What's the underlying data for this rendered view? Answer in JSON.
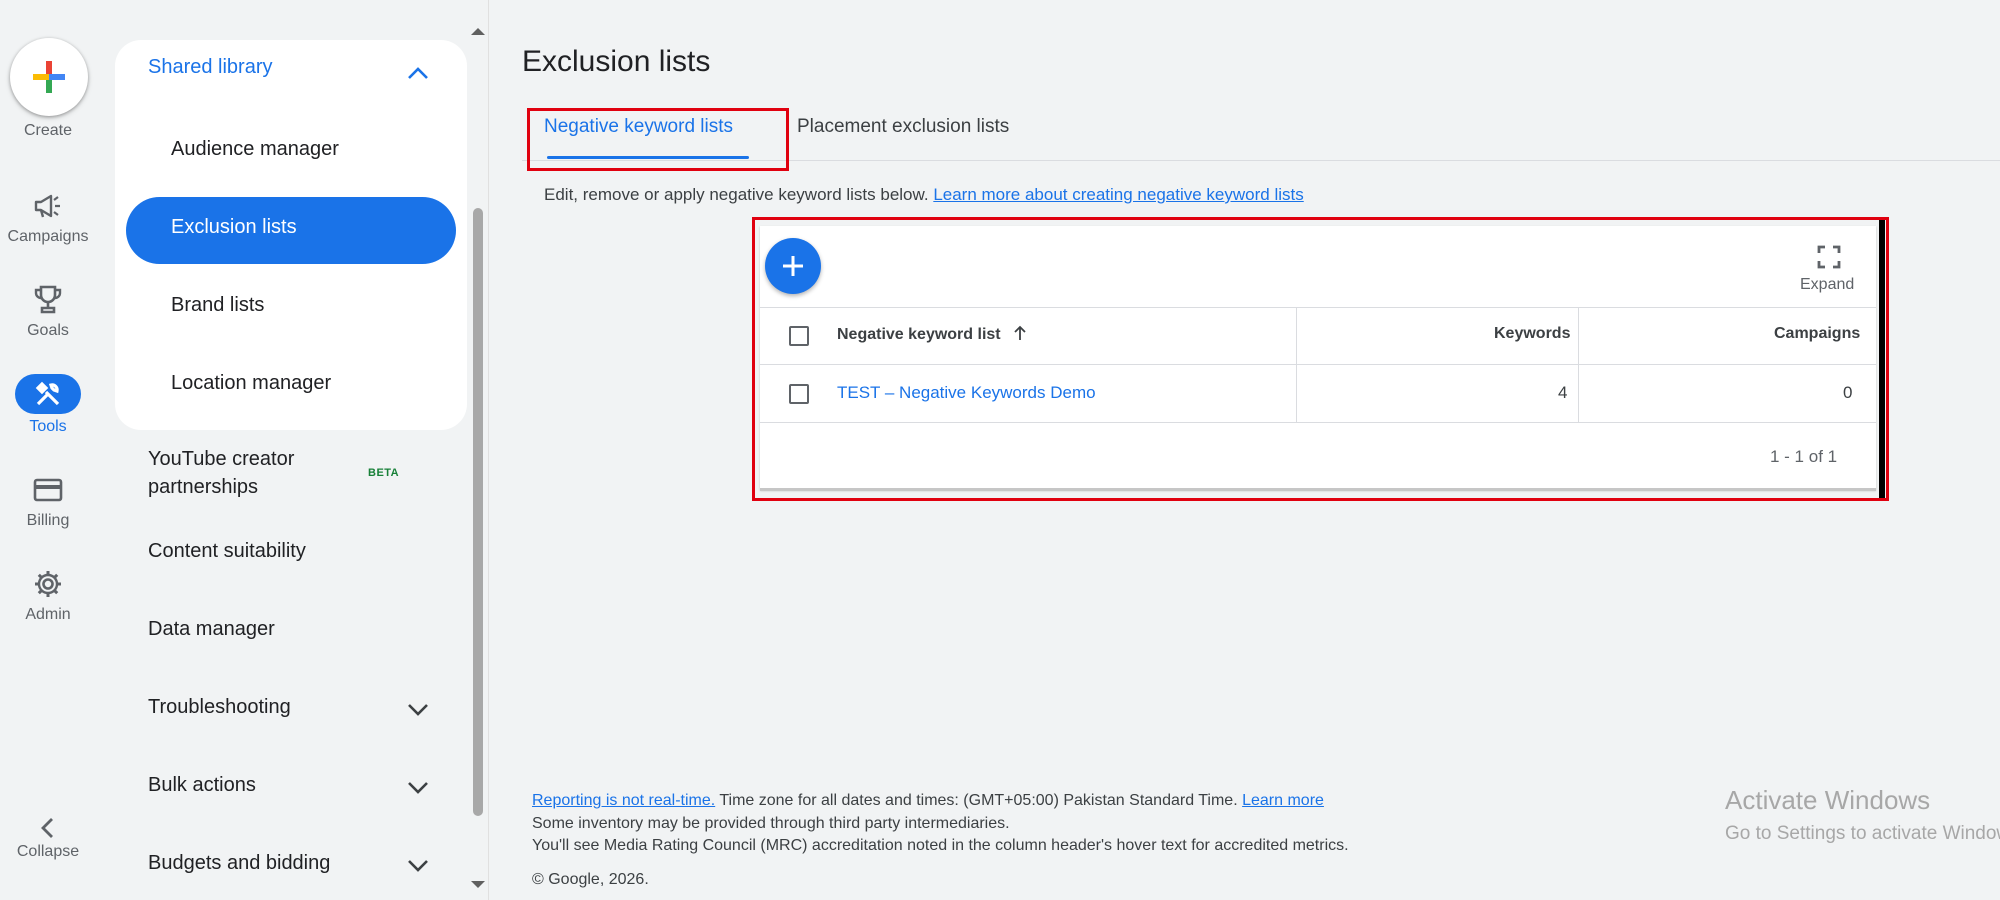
{
  "rail": {
    "create": "Create",
    "items": [
      {
        "label": "Campaigns",
        "icon": "megaphone-icon"
      },
      {
        "label": "Goals",
        "icon": "trophy-icon"
      },
      {
        "label": "Tools",
        "icon": "tools-icon"
      },
      {
        "label": "Billing",
        "icon": "credit-card-icon"
      },
      {
        "label": "Admin",
        "icon": "gear-icon"
      }
    ],
    "collapse": "Collapse"
  },
  "sidebar": {
    "section": "Shared library",
    "sub_items": [
      "Audience manager",
      "Exclusion lists",
      "Brand lists",
      "Location manager"
    ],
    "youtube_line1": "YouTube creator",
    "youtube_line2": "partnerships",
    "beta": "BETA",
    "content_suitability": "Content suitability",
    "data_manager": "Data manager",
    "troubleshooting": "Troubleshooting",
    "bulk_actions": "Bulk actions",
    "budgets_bidding": "Budgets and bidding"
  },
  "main": {
    "title": "Exclusion lists",
    "tabs": [
      "Negative keyword lists",
      "Placement exclusion lists"
    ],
    "description": "Edit, remove or apply negative keyword lists below.",
    "description_link": "Learn more about creating negative keyword lists",
    "expand": "Expand",
    "table": {
      "headers": [
        "Negative keyword list",
        "Keywords",
        "Campaigns"
      ],
      "rows": [
        {
          "name": "TEST – Negative Keywords Demo",
          "keywords": "4",
          "campaigns": "0"
        }
      ],
      "pagination": "1 - 1 of 1"
    }
  },
  "footer": {
    "reporting_link": "Reporting is not real-time.",
    "timezone_text": " Time zone for all dates and times: (GMT+05:00) Pakistan Standard Time.",
    "learn_more": "Learn more",
    "line2": "Some inventory may be provided through third party intermediaries.",
    "line3": "You'll see Media Rating Council (MRC) accreditation noted in the column header's hover text for accredited metrics.",
    "copyright": "© Google, 2026."
  },
  "watermark": {
    "line1": "Activate Windows",
    "line2": "Go to Settings to activate Windows."
  },
  "colors": {
    "accent": "#1a73e8",
    "highlight": "#e0000f"
  }
}
